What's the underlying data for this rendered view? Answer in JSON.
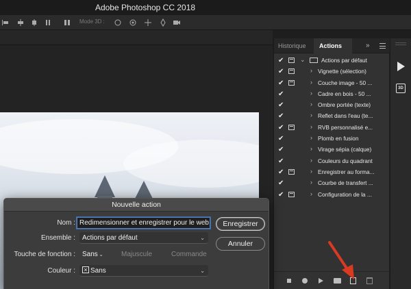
{
  "app": {
    "title": "Adobe Photoshop CC 2018"
  },
  "options_bar": {
    "mode3d_label": "Mode 3D :"
  },
  "panel": {
    "tabs": [
      {
        "label": "Historique",
        "active": false
      },
      {
        "label": "Actions",
        "active": true
      }
    ],
    "collapse_label": "»",
    "actions": [
      {
        "label": "Actions par défaut",
        "checked": true,
        "dialog": true,
        "folder": true,
        "expanded": true
      },
      {
        "label": "Vignette (sélection)",
        "checked": true,
        "dialog": true
      },
      {
        "label": "Couche image - 50 ...",
        "checked": true,
        "dialog": true
      },
      {
        "label": "Cadre en bois - 50 ...",
        "checked": true,
        "dialog": false
      },
      {
        "label": "Ombre portée (texte)",
        "checked": true,
        "dialog": false
      },
      {
        "label": "Reflet dans l'eau (te...",
        "checked": true,
        "dialog": false
      },
      {
        "label": "RVB personnalisé e...",
        "checked": true,
        "dialog": true
      },
      {
        "label": "Plomb en fusion",
        "checked": true,
        "dialog": false
      },
      {
        "label": "Virage sépia (calque)",
        "checked": true,
        "dialog": false
      },
      {
        "label": "Couleurs du quadrant",
        "checked": true,
        "dialog": false
      },
      {
        "label": "Enregistrer au forma...",
        "checked": true,
        "dialog": true
      },
      {
        "label": "Courbe de transfert ...",
        "checked": true,
        "dialog": false
      },
      {
        "label": "Configuration de la ...",
        "checked": true,
        "dialog": true
      }
    ]
  },
  "dialog": {
    "title": "Nouvelle action",
    "nom_label": "Nom :",
    "nom_value": "Redimensionner et enregistrer pour le web",
    "ensemble_label": "Ensemble :",
    "ensemble_value": "Actions par défaut",
    "touche_label": "Touche de fonction :",
    "touche_value": "Sans",
    "majuscule_label": "Majuscule",
    "commande_label": "Commande",
    "couleur_label": "Couleur :",
    "couleur_value": "Sans",
    "ok_label": "Enregistrer",
    "cancel_label": "Annuler"
  },
  "colors": {
    "accent": "#5a7fb0",
    "arrow": "#d83a22"
  }
}
